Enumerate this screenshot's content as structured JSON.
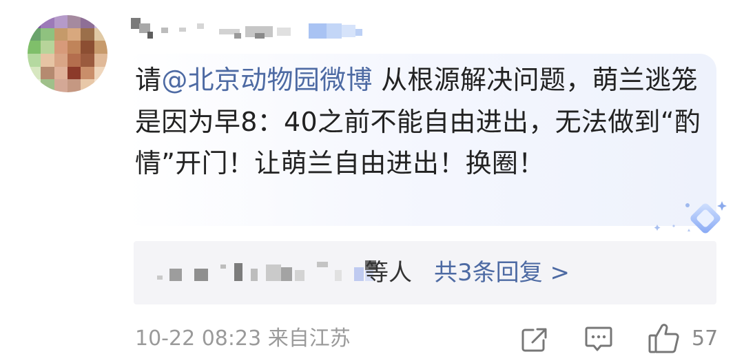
{
  "comment": {
    "prefix": "请",
    "mention": "@北京动物园微博",
    "body": " 从根源解决问题，萌兰逃笼是因为早8：40之前不能自由进出，无法做到“酌情”开门！让萌兰自由进出！换圈！"
  },
  "replies": {
    "suffix": "等人",
    "link": "共3条回复 >"
  },
  "footer": {
    "time_location": "10-22 08:23 来自江苏",
    "like_count": "57"
  },
  "icons": {
    "share": "share-icon",
    "comment": "comment-icon",
    "like": "thumbs-up-icon",
    "badge": "sparkle-badge-icon"
  },
  "colors": {
    "link": "#4d6aa3",
    "text": "#222222",
    "meta": "#9a9a9a"
  }
}
